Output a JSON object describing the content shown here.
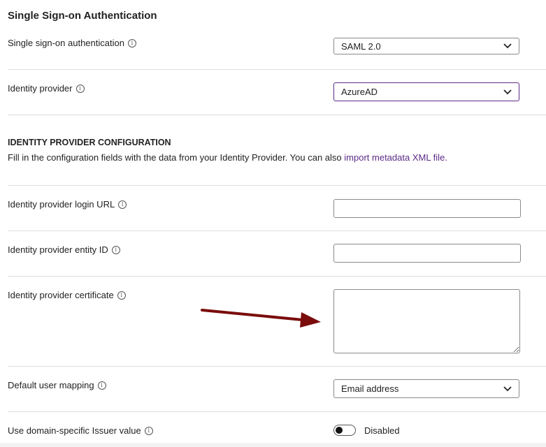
{
  "section_title": "Single Sign-on Authentication",
  "sso_auth": {
    "label": "Single sign-on authentication",
    "value": "SAML 2.0"
  },
  "identity_provider": {
    "label": "Identity provider",
    "value": "AzureAD"
  },
  "config": {
    "heading": "IDENTITY PROVIDER CONFIGURATION",
    "description": "Fill in the configuration fields with the data from your Identity Provider. You can also",
    "link_text": "import metadata XML file."
  },
  "login_url": {
    "label": "Identity provider login URL",
    "value": ""
  },
  "entity_id": {
    "label": "Identity provider entity ID",
    "value": ""
  },
  "certificate": {
    "label": "Identity provider certificate",
    "value": ""
  },
  "user_mapping": {
    "label": "Default user mapping",
    "value": "Email address"
  },
  "issuer": {
    "label": "Use domain-specific Issuer value",
    "state_label": "Disabled",
    "enabled": false
  },
  "info_icon_glyph": "i",
  "colors": {
    "accent": "#5b2b86",
    "arrow": "#7a0c0c"
  }
}
